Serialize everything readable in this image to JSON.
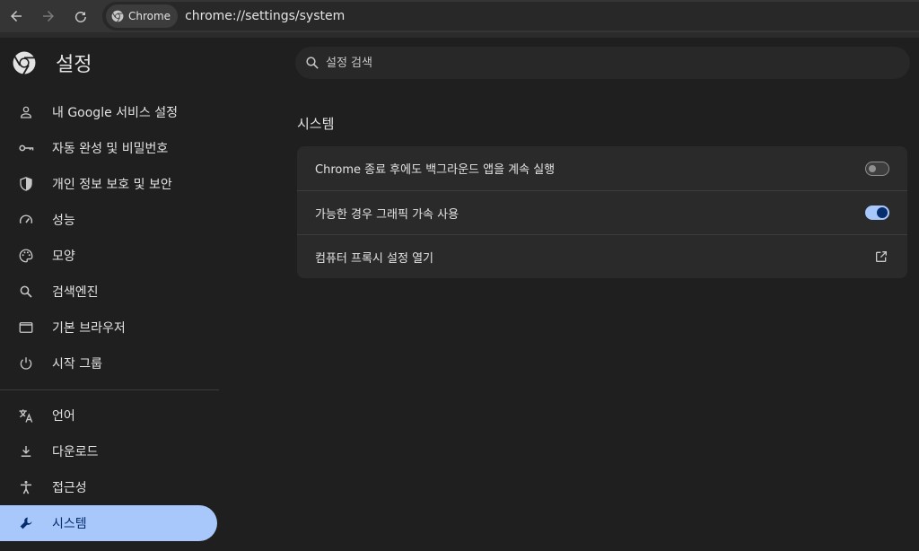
{
  "browser": {
    "chip_label": "Chrome",
    "url": "chrome://settings/system"
  },
  "app": {
    "title": "설정"
  },
  "search": {
    "placeholder": "설정 검색"
  },
  "sidebar": {
    "items": [
      {
        "label": "내 Google 서비스 설정",
        "icon": "person-icon"
      },
      {
        "label": "자동 완성 및 비밀번호",
        "icon": "key-icon"
      },
      {
        "label": "개인 정보 보호 및 보안",
        "icon": "shield-icon"
      },
      {
        "label": "성능",
        "icon": "speedometer-icon"
      },
      {
        "label": "모양",
        "icon": "palette-icon"
      },
      {
        "label": "검색엔진",
        "icon": "search-icon"
      },
      {
        "label": "기본 브라우저",
        "icon": "browser-window-icon"
      },
      {
        "label": "시작 그룹",
        "icon": "power-icon"
      }
    ],
    "items2": [
      {
        "label": "언어",
        "icon": "translate-icon"
      },
      {
        "label": "다운로드",
        "icon": "download-icon"
      },
      {
        "label": "접근성",
        "icon": "accessibility-icon"
      },
      {
        "label": "시스템",
        "icon": "wrench-icon",
        "active": true
      }
    ]
  },
  "section": {
    "title": "시스템",
    "rows": [
      {
        "label": "Chrome 종료 후에도 백그라운드 앱을 계속 실행",
        "control": "toggle",
        "on": false
      },
      {
        "label": "가능한 경우 그래픽 가속 사용",
        "control": "toggle",
        "on": true
      },
      {
        "label": "컴퓨터 프록시 설정 열기",
        "control": "external-link"
      }
    ]
  },
  "colors": {
    "background": "#1f1f1f",
    "active_item": "#a8c7fa",
    "toggle_on": "#a8c7fa"
  }
}
